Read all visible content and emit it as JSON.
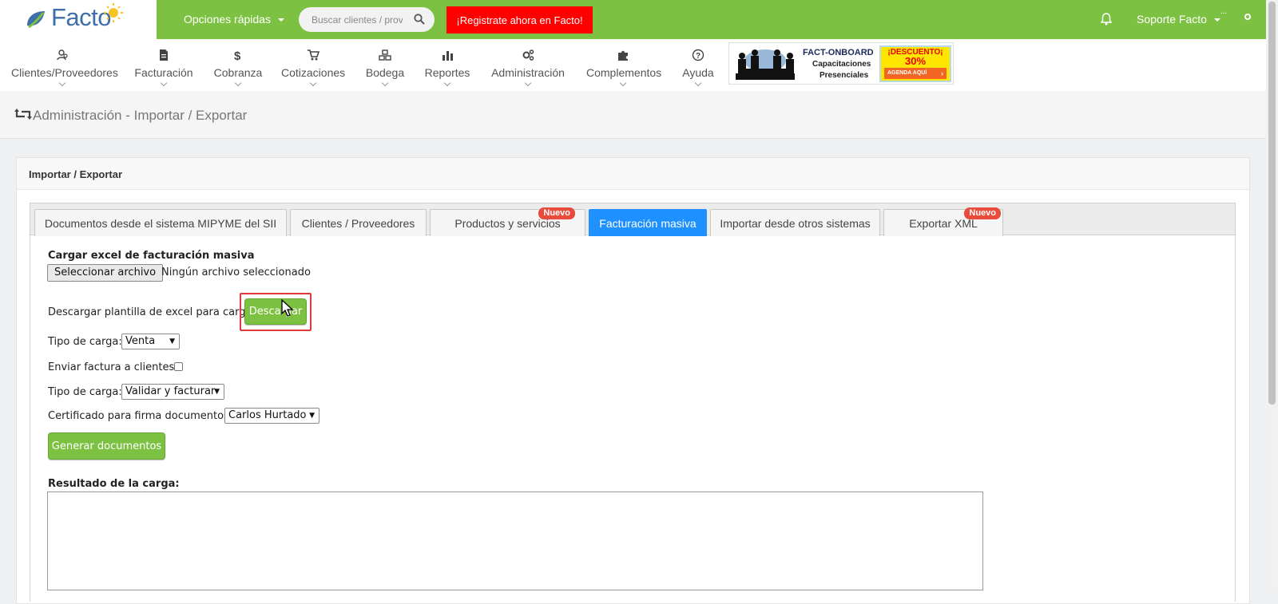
{
  "header": {
    "logo_text": "Facto",
    "quick_options": "Opciones rápidas",
    "search_placeholder": "Buscar clientes / prov",
    "register_cta": "¡Registrate ahora en Facto!",
    "user_name": "Soporte Facto",
    "avatar_alt": "..."
  },
  "nav": {
    "items": [
      {
        "label": "Clientes/Proveedores",
        "icon": "users-icon"
      },
      {
        "label": "Facturación",
        "icon": "file-icon"
      },
      {
        "label": "Cobranza",
        "icon": "dollar-icon"
      },
      {
        "label": "Cotizaciones",
        "icon": "cart-icon"
      },
      {
        "label": "Bodega",
        "icon": "boxes-icon"
      },
      {
        "label": "Reportes",
        "icon": "bar-chart-icon"
      },
      {
        "label": "Administración",
        "icon": "gears-icon"
      },
      {
        "label": "Complementos",
        "icon": "puzzle-icon"
      },
      {
        "label": "Ayuda",
        "icon": "question-icon"
      }
    ]
  },
  "banner": {
    "title": "FACT-ONBOARD",
    "line2": "Capacitaciones",
    "line3": "Presenciales",
    "discount_label": "¡DESCUENTO¡",
    "discount_value": "30%",
    "cta": "AGENDA AQUÍ",
    "cta_arrow": "›"
  },
  "page": {
    "breadcrumb_title": "Administración - Importar / Exportar",
    "panel_title": "Importar / Exportar"
  },
  "tabs": [
    {
      "label": "Documentos desde el sistema MIPYME del SII",
      "active": false,
      "badge": ""
    },
    {
      "label": "Clientes / Proveedores",
      "active": false,
      "badge": ""
    },
    {
      "label": "Productos y servicios",
      "active": false,
      "badge": "Nuevo"
    },
    {
      "label": "Facturación masiva",
      "active": true,
      "badge": ""
    },
    {
      "label": "Importar desde otros sistemas",
      "active": false,
      "badge": ""
    },
    {
      "label": "Exportar XML",
      "active": false,
      "badge": "Nuevo"
    }
  ],
  "form": {
    "upload_label": "Cargar excel de facturación masiva",
    "file_button": "Seleccionar archivo",
    "file_status": "Ningún archivo seleccionado",
    "download_label": "Descargar plantilla de excel para carga",
    "download_button": "Descargar",
    "load_type_label": "Tipo de carga:",
    "load_type_value": "Venta",
    "send_invoice_label": "Enviar factura a clientes:",
    "send_invoice_checked": false,
    "load_mode_label": "Tipo de carga:",
    "load_mode_value": "Validar y facturar",
    "certificate_label": "Certificado para firma documentos:",
    "certificate_value": "Carlos Hurtado",
    "generate_button": "Generar documentos",
    "result_label": "Resultado de la carga:",
    "result_text": ""
  },
  "colors": {
    "brand_green": "#7dc142",
    "active_tab": "#1e90ff",
    "cta_red": "#ff0000",
    "badge_red": "#e74c3c",
    "highlight_red": "#e03a3a"
  }
}
